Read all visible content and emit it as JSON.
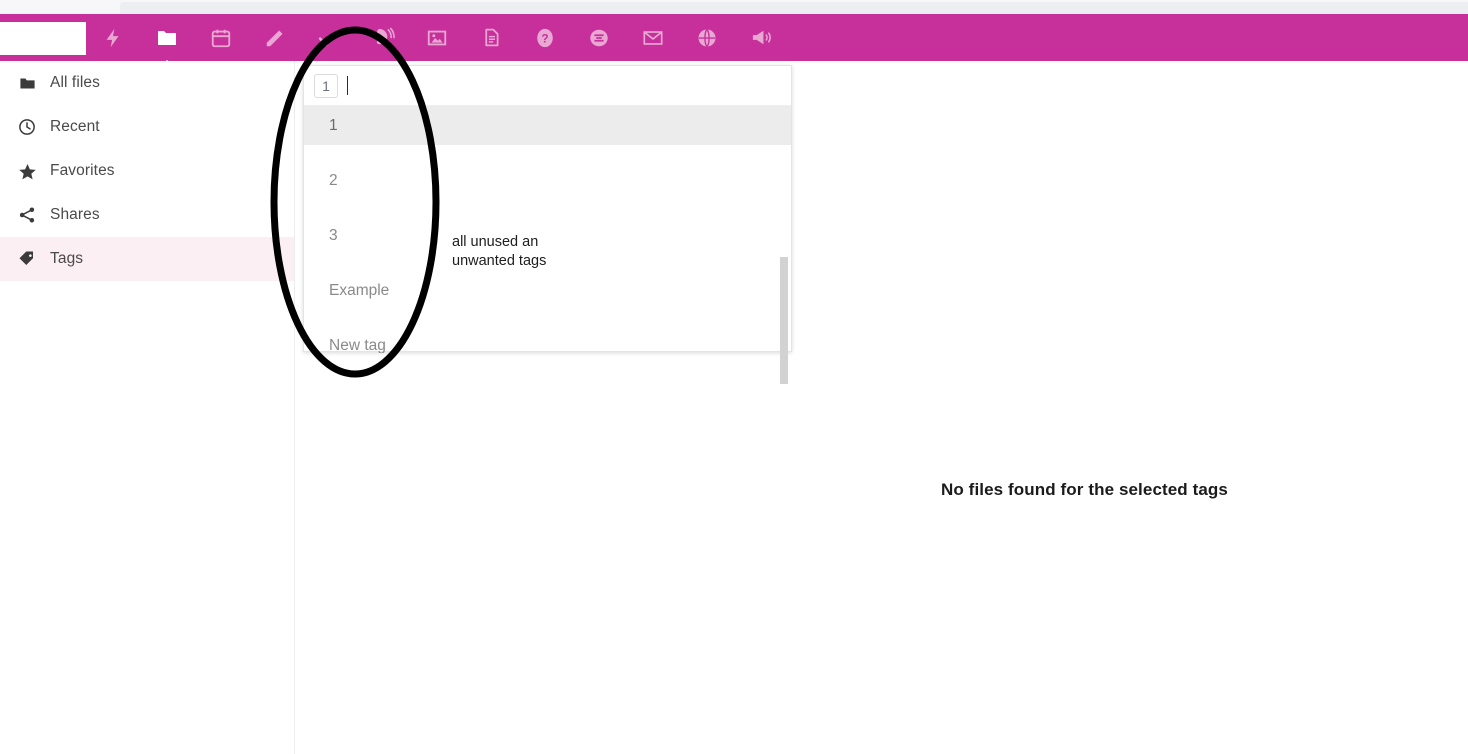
{
  "browser": {
    "strip_label": ""
  },
  "topbar": {
    "accent_color": "#c7309b",
    "icon_inactive_color": "#e9a8d3",
    "logo_label": "",
    "items": [
      {
        "name": "activity-icon",
        "label": "Activity",
        "active": false
      },
      {
        "name": "files-folder-icon",
        "label": "Files",
        "active": true
      },
      {
        "name": "calendar-icon",
        "label": "Calendar",
        "active": false
      },
      {
        "name": "notes-pencil-icon",
        "label": "Notes",
        "active": false
      },
      {
        "name": "tasks-check-icon",
        "label": "Tasks",
        "active": false
      },
      {
        "name": "talk-phone-icon",
        "label": "Talk",
        "active": false
      },
      {
        "name": "photos-image-icon",
        "label": "Photos",
        "active": false
      },
      {
        "name": "text-document-icon",
        "label": "Text",
        "active": false
      },
      {
        "name": "help-question-icon",
        "label": "Help",
        "active": false
      },
      {
        "name": "circles-icon",
        "label": "Circles",
        "active": false
      },
      {
        "name": "mail-envelope-icon",
        "label": "Mail",
        "active": false
      },
      {
        "name": "web-globe-icon",
        "label": "Web",
        "active": false
      },
      {
        "name": "announcements-megaphone-icon",
        "label": "Announcements",
        "active": false
      }
    ]
  },
  "sidebar": {
    "items": [
      {
        "label": "All files",
        "icon": "folder-icon",
        "selected": false
      },
      {
        "label": "Recent",
        "icon": "clock-icon",
        "selected": false
      },
      {
        "label": "Favorites",
        "icon": "star-icon",
        "selected": false
      },
      {
        "label": "Shares",
        "icon": "share-icon",
        "selected": false
      },
      {
        "label": "Tags",
        "icon": "tag-icon",
        "selected": true
      }
    ],
    "selected_highlight_color": "#fbeff4"
  },
  "tag_panel": {
    "input": {
      "chips": [
        "1"
      ],
      "value": "",
      "placeholder": ""
    },
    "options": [
      {
        "label": "1",
        "highlighted": true
      },
      {
        "label": "2",
        "highlighted": false
      },
      {
        "label": "3",
        "highlighted": false
      },
      {
        "label": "Example",
        "highlighted": false
      },
      {
        "label": "New tag",
        "highlighted": false
      }
    ]
  },
  "annotations": {
    "ellipse_name": "hand-drawn-ellipse",
    "note_text": "all unused an\nunwanted tags"
  },
  "main": {
    "empty_message": "No files found for the selected tags"
  }
}
